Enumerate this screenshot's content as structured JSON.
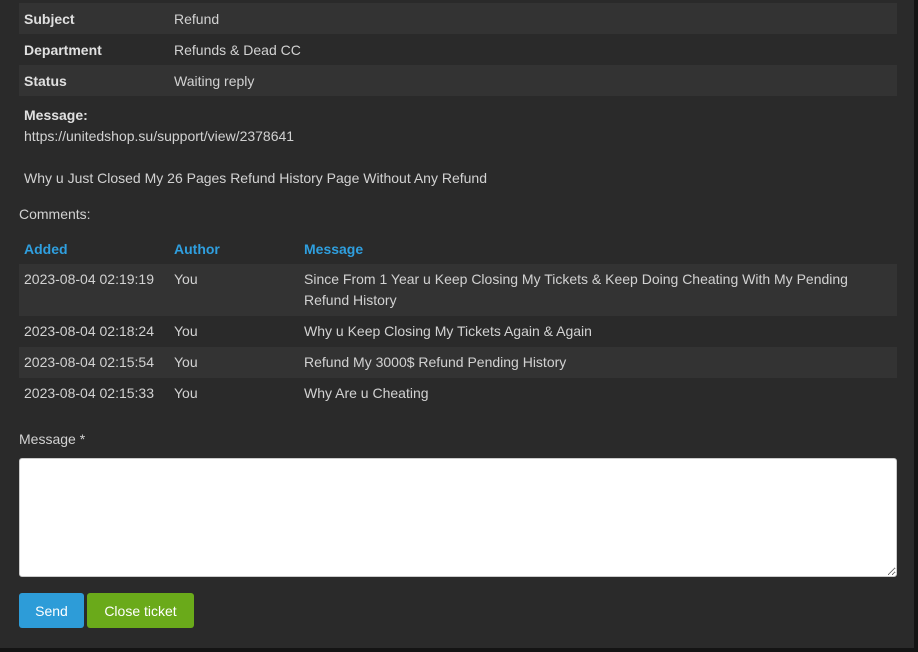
{
  "ticket": {
    "fields": [
      {
        "label": "Subject",
        "value": "Refund"
      },
      {
        "label": "Department",
        "value": "Refunds & Dead CC"
      },
      {
        "label": "Status",
        "value": "Waiting reply"
      }
    ],
    "message_label": "Message:",
    "message_lines": [
      "https://unitedshop.su/support/view/2378641",
      "Why u Just Closed My 26 Pages Refund History Page Without Any Refund"
    ]
  },
  "comments": {
    "label": "Comments:",
    "headers": {
      "added": "Added",
      "author": "Author",
      "message": "Message"
    },
    "rows": [
      {
        "added": "2023-08-04 02:19:19",
        "author": "You",
        "message": "Since From 1 Year u Keep Closing My Tickets & Keep Doing Cheating With My Pending Refund History"
      },
      {
        "added": "2023-08-04 02:18:24",
        "author": "You",
        "message": "Why u Keep Closing My Tickets Again & Again"
      },
      {
        "added": "2023-08-04 02:15:54",
        "author": "You",
        "message": "Refund My 3000$ Refund Pending History"
      },
      {
        "added": "2023-08-04 02:15:33",
        "author": "You",
        "message": "Why Are u Cheating"
      }
    ]
  },
  "reply": {
    "label": "Message *",
    "value": "",
    "send_label": "Send",
    "close_label": "Close ticket"
  },
  "colors": {
    "background": "#2a2a2a",
    "stripe": "#333333",
    "link_blue": "#2f9fdf",
    "send_button": "#2d9cd8",
    "close_button": "#6aaa1a"
  }
}
